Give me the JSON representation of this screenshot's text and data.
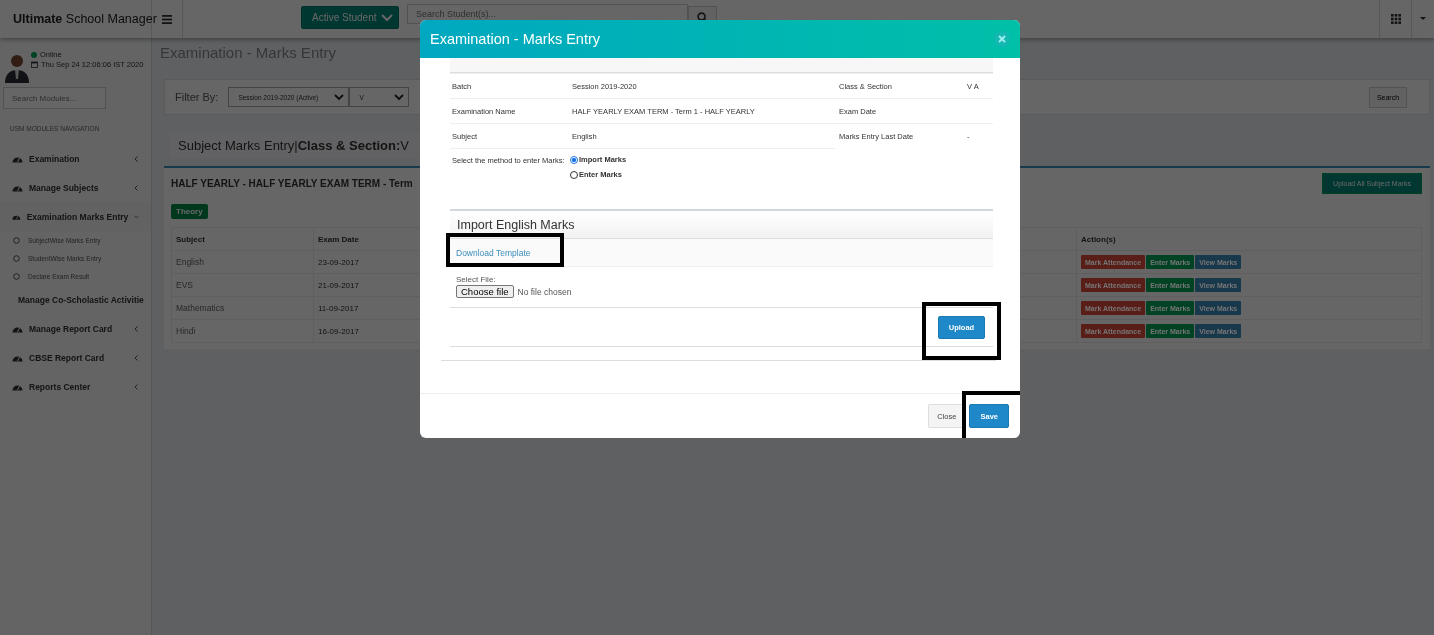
{
  "header": {
    "brand": "**Ultimate** School Manager",
    "student_filter": "Active Student",
    "search": {
      "placeholder": "Search Student(s)..."
    }
  },
  "sidebar": {
    "user": {
      "status": "Online",
      "datetime": "Thu Sep 24 12:06:06 IST 2020"
    },
    "search": {
      "placeholder": "Search Modules..."
    },
    "section_label": "USM MODULES NAVIGATION",
    "items": [
      {
        "label": "Examination",
        "expanded": false
      },
      {
        "label": "Manage Subjects",
        "expanded": false
      },
      {
        "label": "Examination Marks Entry",
        "expanded": true,
        "children": [
          {
            "label": "SubjectWise Marks Entry"
          },
          {
            "label": "StudentWise Marks Entry"
          },
          {
            "label": "Declare Exam Result"
          }
        ]
      },
      {
        "label": "Manage Co-Scholastic Activitie"
      },
      {
        "label": "Manage Report Card",
        "expanded": false
      },
      {
        "label": "CBSE Report Card",
        "expanded": false
      },
      {
        "label": "Reports Center",
        "expanded": false
      }
    ]
  },
  "main": {
    "page_title": "Examination - Marks Entry",
    "filter": {
      "label": "Filter By:",
      "selects": [
        "Session 2019-2020 (Active)",
        "V"
      ],
      "search_button": "Search"
    },
    "panel_title": "Subject Marks Entry|**Class & Section:**V",
    "exam": {
      "title": "HALF YEARLY - HALF YEARLY EXAM TERM - Term",
      "upload_button": "Upload All Subject Marks",
      "badge": "Theory",
      "columns": [
        "Subject",
        "Exam Date",
        "Action(s)"
      ],
      "rows": [
        {
          "subject": "English",
          "exam_date": "23-09-2017",
          "actions": [
            {
              "label": "Mark Attendance",
              "color": "#581e17"
            },
            {
              "label": "Enter Marks",
              "color": "#004224"
            },
            {
              "label": "View Marks",
              "color": "#18384b"
            }
          ]
        },
        {
          "subject": "EVS",
          "exam_date": "21-09-2017",
          "actions": [
            {
              "label": "Mark Attendance",
              "color": "#581e17"
            },
            {
              "label": "Enter Marks",
              "color": "#004224"
            },
            {
              "label": "View Marks",
              "color": "#18384b"
            }
          ]
        },
        {
          "subject": "Mathematics",
          "exam_date": "11-09-2017",
          "actions": [
            {
              "label": "Mark Attendance",
              "color": "#581e17"
            },
            {
              "label": "Enter Marks",
              "color": "#004224"
            },
            {
              "label": "View Marks",
              "color": "#18384b"
            }
          ]
        },
        {
          "subject": "Hindi",
          "exam_date": "16-09-2017",
          "actions": [
            {
              "label": "Mark Attendance",
              "color": "#581e17"
            },
            {
              "label": "Enter Marks",
              "color": "#004224"
            },
            {
              "label": "View Marks",
              "color": "#18384b"
            }
          ]
        }
      ]
    }
  },
  "modal": {
    "title": "Examination - Marks Entry",
    "details": [
      {
        "label": "Batch",
        "value": "Session 2019-2020",
        "label2": "Class & Section",
        "value2": "V A"
      },
      {
        "label": "Examination Name",
        "value": "HALF YEARLY EXAM TERM - Term 1 - HALF YEARLY",
        "label2": "Exam Date"
      },
      {
        "label": "Subject",
        "value": "English",
        "label2": "Marks Entry Last Date",
        "value2": "-"
      }
    ],
    "method": {
      "label": "Select the method to enter Marks:",
      "options": [
        {
          "label": "Import Marks",
          "selected": true
        },
        {
          "label": "Enter Marks",
          "selected": false
        }
      ]
    },
    "import": {
      "title": "Import English Marks",
      "template_link": "Download Template",
      "template_highlighted": true,
      "file_label": "Select File:",
      "choose_button": "Choose file",
      "file_status": "No file chosen",
      "upload_button": "Upload",
      "upload_highlighted": true
    },
    "buttons": [
      {
        "label": "Close",
        "kind": "default"
      },
      {
        "label": "Save",
        "kind": "primary",
        "highlighted": true
      }
    ]
  }
}
